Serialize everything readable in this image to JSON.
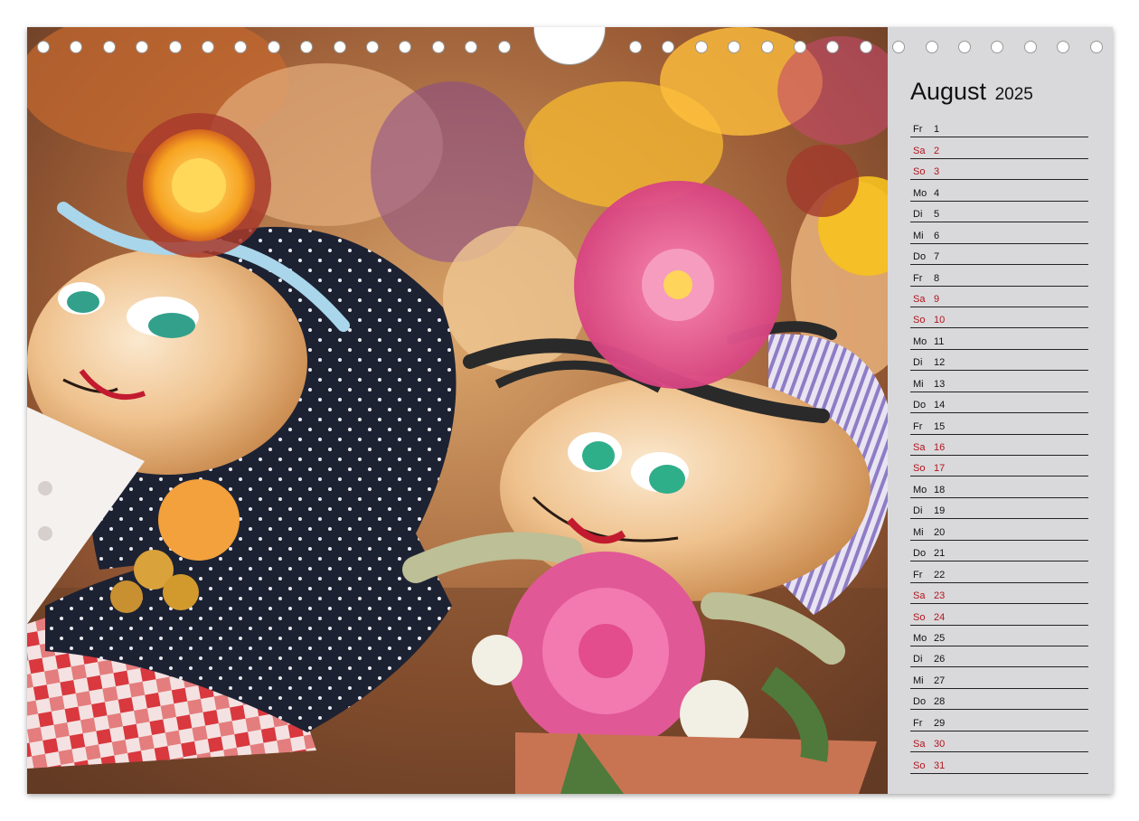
{
  "calendar": {
    "month": "August",
    "year": "2025",
    "days": [
      {
        "wd": "Fr",
        "d": "1",
        "weekend": false
      },
      {
        "wd": "Sa",
        "d": "2",
        "weekend": true
      },
      {
        "wd": "So",
        "d": "3",
        "weekend": true
      },
      {
        "wd": "Mo",
        "d": "4",
        "weekend": false
      },
      {
        "wd": "Di",
        "d": "5",
        "weekend": false
      },
      {
        "wd": "Mi",
        "d": "6",
        "weekend": false
      },
      {
        "wd": "Do",
        "d": "7",
        "weekend": false
      },
      {
        "wd": "Fr",
        "d": "8",
        "weekend": false
      },
      {
        "wd": "Sa",
        "d": "9",
        "weekend": true
      },
      {
        "wd": "So",
        "d": "10",
        "weekend": true
      },
      {
        "wd": "Mo",
        "d": "11",
        "weekend": false
      },
      {
        "wd": "Di",
        "d": "12",
        "weekend": false
      },
      {
        "wd": "Mi",
        "d": "13",
        "weekend": false
      },
      {
        "wd": "Do",
        "d": "14",
        "weekend": false
      },
      {
        "wd": "Fr",
        "d": "15",
        "weekend": false
      },
      {
        "wd": "Sa",
        "d": "16",
        "weekend": true
      },
      {
        "wd": "So",
        "d": "17",
        "weekend": true
      },
      {
        "wd": "Mo",
        "d": "18",
        "weekend": false
      },
      {
        "wd": "Di",
        "d": "19",
        "weekend": false
      },
      {
        "wd": "Mi",
        "d": "20",
        "weekend": false
      },
      {
        "wd": "Do",
        "d": "21",
        "weekend": false
      },
      {
        "wd": "Fr",
        "d": "22",
        "weekend": false
      },
      {
        "wd": "Sa",
        "d": "23",
        "weekend": true
      },
      {
        "wd": "So",
        "d": "24",
        "weekend": true
      },
      {
        "wd": "Mo",
        "d": "25",
        "weekend": false
      },
      {
        "wd": "Di",
        "d": "26",
        "weekend": false
      },
      {
        "wd": "Mi",
        "d": "27",
        "weekend": false
      },
      {
        "wd": "Do",
        "d": "28",
        "weekend": false
      },
      {
        "wd": "Fr",
        "d": "29",
        "weekend": false
      },
      {
        "wd": "Sa",
        "d": "30",
        "weekend": true
      },
      {
        "wd": "So",
        "d": "31",
        "weekend": true
      }
    ]
  },
  "colors": {
    "weekend": "#b3131d",
    "weekday": "#111111",
    "sidebar": "#d9d9db"
  }
}
